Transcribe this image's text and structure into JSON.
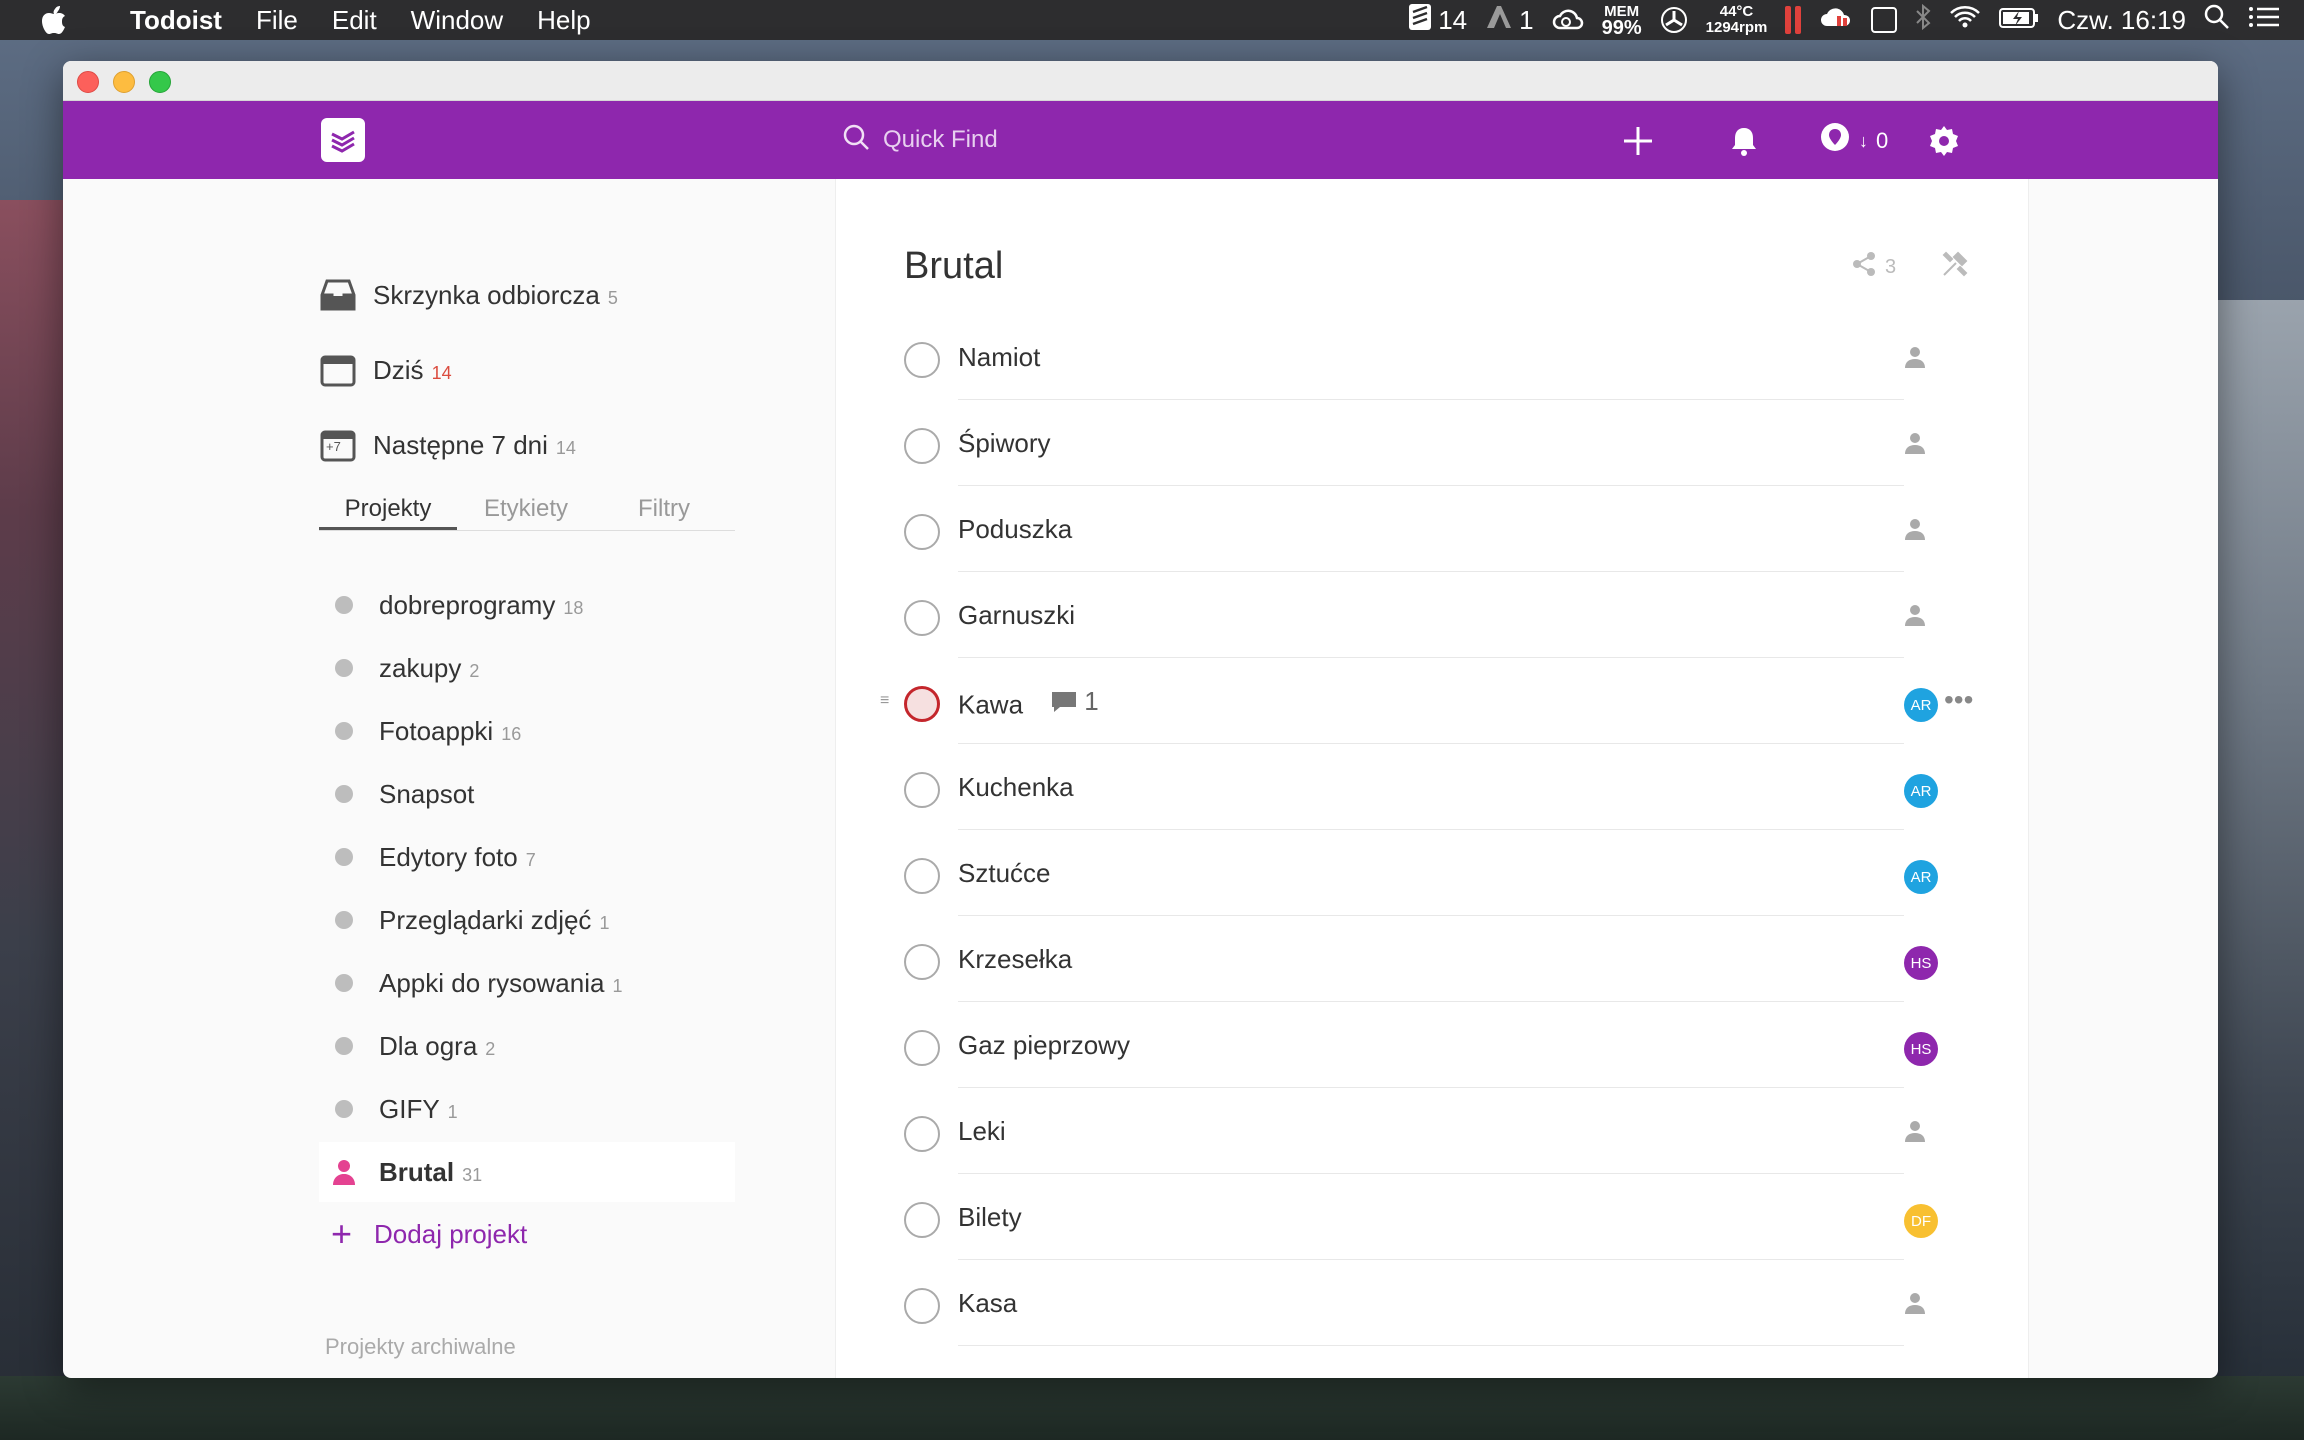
{
  "menubar": {
    "app_name": "Todoist",
    "menus": [
      "File",
      "Edit",
      "Window",
      "Help"
    ],
    "todoist_count": "14",
    "adobe_count": "1",
    "mem_label": "MEM",
    "mem_value": "99%",
    "temp": "44°C",
    "rpm": "1294rpm",
    "clock": "Czw. 16:19"
  },
  "topbar": {
    "search_placeholder": "Quick Find",
    "karma_count": "0"
  },
  "sidebar": {
    "nav": [
      {
        "label": "Skrzynka odbiorcza",
        "count": "5"
      },
      {
        "label": "Dziś",
        "count": "14"
      },
      {
        "label": "Następne 7 dni",
        "count": "14"
      }
    ],
    "tabs": [
      "Projekty",
      "Etykiety",
      "Filtry"
    ],
    "projects": [
      {
        "label": "dobreprogramy",
        "count": "18"
      },
      {
        "label": "zakupy",
        "count": "2"
      },
      {
        "label": "Fotoappki",
        "count": "16"
      },
      {
        "label": "Snapsot",
        "count": ""
      },
      {
        "label": "Edytory foto",
        "count": "7"
      },
      {
        "label": "Przeglądarki zdjęć",
        "count": "1"
      },
      {
        "label": "Appki do rysowania",
        "count": "1"
      },
      {
        "label": "Dla ogra",
        "count": "2"
      },
      {
        "label": "GIFY",
        "count": "1"
      },
      {
        "label": "Brutal",
        "count": "31"
      }
    ],
    "add_project": "Dodaj projekt",
    "archived": "Projekty archiwalne",
    "calendar_plus7": "+7"
  },
  "main": {
    "title": "Brutal",
    "share_count": "3",
    "tasks": [
      {
        "label": "Namiot",
        "assignee": ""
      },
      {
        "label": "Śpiwory",
        "assignee": ""
      },
      {
        "label": "Poduszka",
        "assignee": ""
      },
      {
        "label": "Garnuszki",
        "assignee": ""
      },
      {
        "label": "Kawa",
        "assignee": "AR",
        "comments": "1"
      },
      {
        "label": "Kuchenka",
        "assignee": "AR"
      },
      {
        "label": "Sztućce",
        "assignee": "AR"
      },
      {
        "label": "Krzesełka",
        "assignee": "HS"
      },
      {
        "label": "Gaz pieprzowy",
        "assignee": "HS"
      },
      {
        "label": "Leki",
        "assignee": ""
      },
      {
        "label": "Bilety",
        "assignee": "DF"
      },
      {
        "label": "Kasa",
        "assignee": ""
      }
    ]
  },
  "colors": {
    "brand": "#8e27ad",
    "avatar_ar": "#1fa3e0",
    "avatar_hs": "#8e27ad",
    "avatar_df": "#f8c031",
    "today_count": "#db4c3f"
  }
}
